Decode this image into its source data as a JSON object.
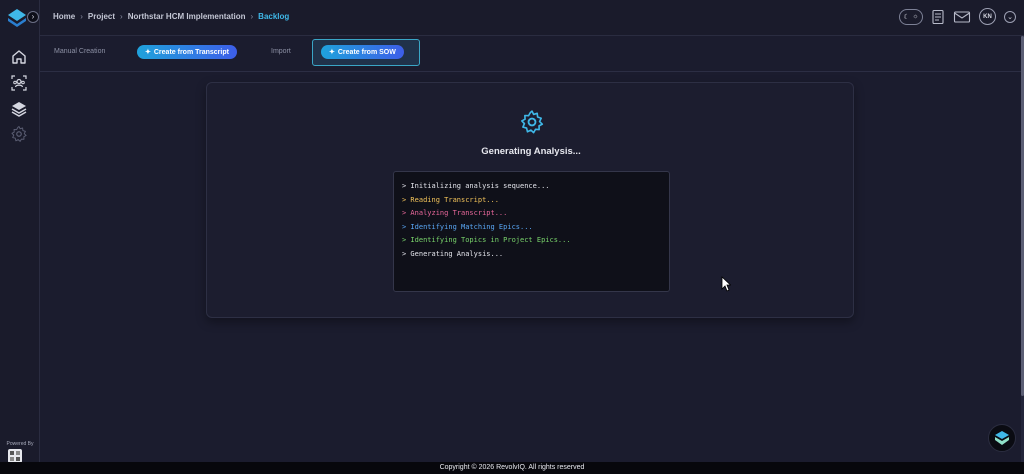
{
  "breadcrumb": {
    "items": [
      "Home",
      "Project",
      "Northstar HCM Implementation"
    ],
    "active": "Backlog"
  },
  "header": {
    "avatar_initials": "KN"
  },
  "tabs": {
    "manual": "Manual Creation",
    "transcript": "Create from Transcript",
    "import": "Import",
    "sow": "Create from SOW"
  },
  "analysis": {
    "title": "Generating Analysis...",
    "log": [
      {
        "text": "> Initializing analysis sequence...",
        "color": "#e4e5ec"
      },
      {
        "text": "> Reading Transcript...",
        "color": "#f2c35a"
      },
      {
        "text": "> Analyzing Transcript...",
        "color": "#e8679a"
      },
      {
        "text": "> Identifying Matching Epics...",
        "color": "#5aa7f5"
      },
      {
        "text": "> Identifying Topics in Project Epics...",
        "color": "#79d36b"
      },
      {
        "text": "> Generating Analysis...",
        "color": "#e4e5ec"
      }
    ]
  },
  "sidebar": {
    "powered_by": "Powered By"
  },
  "footer": {
    "copyright": "Copyright © 2026 RevolvIQ. All rights reserved"
  },
  "colors": {
    "accent": "#3fb8e8",
    "background": "#1b1c2e",
    "pill_gradient_start": "#1fa2dc",
    "pill_gradient_end": "#3d5ee8"
  },
  "icons": {
    "logo": "logo-icon",
    "home": "home-icon",
    "team": "team-icon",
    "layers": "layers-icon",
    "settings": "settings-gear-icon",
    "sparkle": "sparkle-icon",
    "gear": "gear-icon"
  }
}
